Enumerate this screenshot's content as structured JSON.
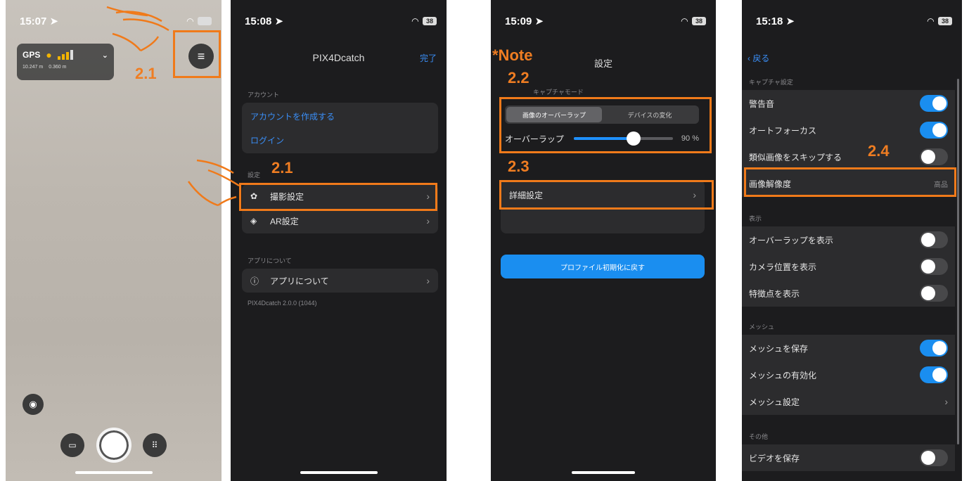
{
  "colors": {
    "accent": "#1a8ef0",
    "annotation": "#f07a1a",
    "link": "#3a8ef6"
  },
  "phone1": {
    "time": "15:07",
    "battery": "",
    "gps": {
      "label": "GPS",
      "pin_icon": "location-pin-icon",
      "stat1": "10.247 m",
      "stat2": "0.360 m"
    },
    "menu_icon": "hamburger-menu-icon",
    "annotation": "2.1"
  },
  "phone2": {
    "time": "15:08",
    "battery": "38",
    "title": "PIX4Dcatch",
    "done": "完了",
    "account_section": "アカウント",
    "create_account": "アカウントを作成する",
    "login": "ログイン",
    "settings_section": "設定",
    "capture_settings": "撮影設定",
    "ar_settings": "AR設定",
    "about_section": "アプリについて",
    "about": "アプリについて",
    "version": "PIX4Dcatch 2.0.0 (1044)",
    "annotation": "2.1"
  },
  "phone3": {
    "time": "15:09",
    "battery": "38",
    "title": "設定",
    "section_label": "キャプチャモード",
    "seg_option1": "画像のオーバーラップ",
    "seg_option2": "デバイスの変化",
    "overlap_label": "オーバーラップ",
    "overlap_value": "90 %",
    "overlap_fraction": 0.6,
    "detail_settings": "詳細設定",
    "reset_button": "プロファイル初期化に戻す",
    "note": "*Note",
    "annotation_2_2": "2.2",
    "annotation_2_3": "2.3"
  },
  "phone4": {
    "time": "15:18",
    "battery": "38",
    "back": "戻る",
    "capture_section": "キャプチャ設定",
    "shutter_sound": "警告音",
    "autofocus": "オートフォーカス",
    "skip_similar": "類似画像をスキップする",
    "image_quality": "画像解像度",
    "image_quality_value": "高品",
    "display_section": "表示",
    "show_overlap": "オーバーラップを表示",
    "show_camera_position": "カメラ位置を表示",
    "show_features": "特徴点を表示",
    "mesh_section": "メッシュ",
    "save_mesh": "メッシュを保存",
    "enable_mesh": "メッシュの有効化",
    "mesh_settings": "メッシュ設定",
    "other_section": "その他",
    "save_video": "ビデオを保存",
    "annotation": "2.4"
  }
}
